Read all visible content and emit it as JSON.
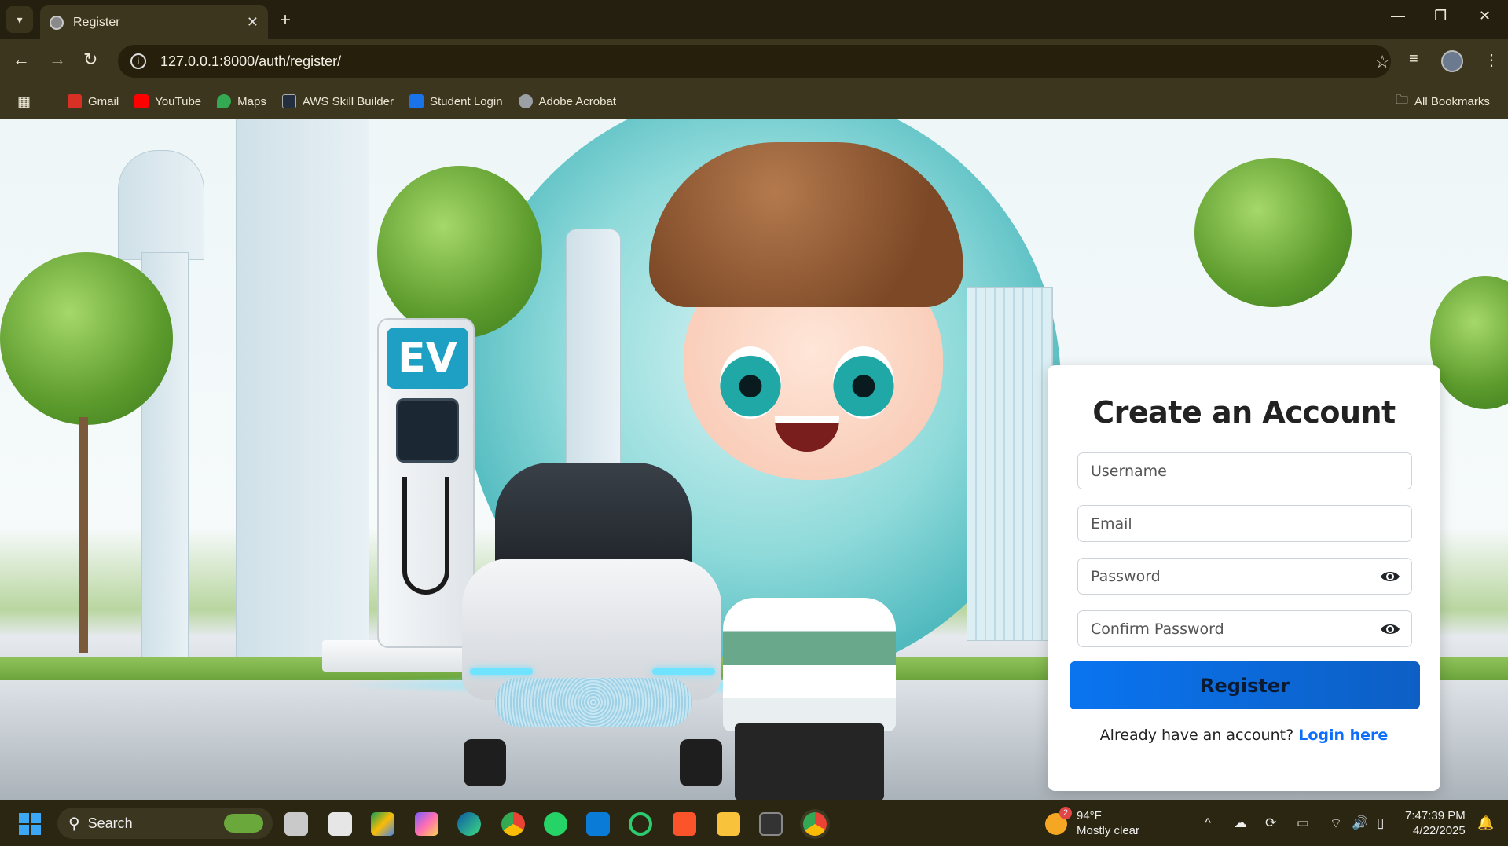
{
  "browser": {
    "tab_title": "Register",
    "new_tab_symbol": "+",
    "url": "127.0.0.1:8000/auth/register/",
    "bookmarks": [
      {
        "label": "Gmail",
        "icon": "gmail-icon",
        "color": "#d93025"
      },
      {
        "label": "YouTube",
        "icon": "youtube-icon",
        "color": "#ff0000"
      },
      {
        "label": "Maps",
        "icon": "maps-icon",
        "color": "#34a853"
      },
      {
        "label": "AWS Skill Builder",
        "icon": "aws-icon",
        "color": "#232f3e"
      },
      {
        "label": "Student Login",
        "icon": "student-login-icon",
        "color": "#1a73e8"
      },
      {
        "label": "Adobe Acrobat",
        "icon": "globe-icon",
        "color": "#9aa0a6"
      }
    ],
    "all_bookmarks_label": "All Bookmarks"
  },
  "page": {
    "charger_label": "EV"
  },
  "form": {
    "title": "Create an Account",
    "username_placeholder": "Username",
    "email_placeholder": "Email",
    "password_placeholder": "Password",
    "confirm_password_placeholder": "Confirm Password",
    "register_label": "Register",
    "login_prompt": "Already have an account?",
    "login_link": "Login here",
    "colors": {
      "primary": "#0d6efd",
      "link": "#0d6efd"
    }
  },
  "taskbar": {
    "search_label": "Search",
    "weather_temp": "94°F",
    "weather_desc": "Mostly clear",
    "weather_badge": "2",
    "time": "7:47:39 PM",
    "date": "4/22/2025"
  }
}
